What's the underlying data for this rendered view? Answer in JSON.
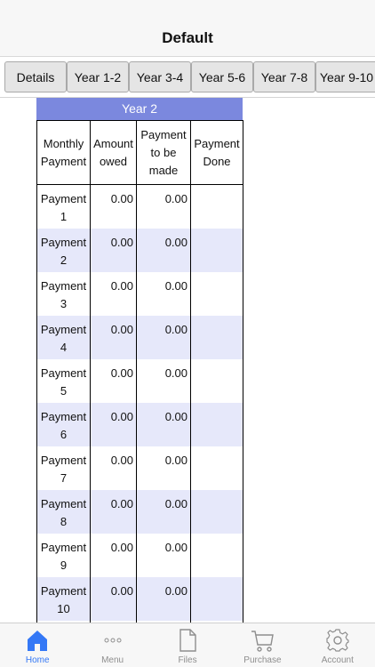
{
  "header": {
    "title": "Default"
  },
  "tabs": [
    {
      "label": "Details"
    },
    {
      "label": "Year 1-2"
    },
    {
      "label": "Year 3-4"
    },
    {
      "label": "Year 5-6"
    },
    {
      "label": "Year 7-8"
    },
    {
      "label": "Year 9-10"
    }
  ],
  "table": {
    "title": "Year 2",
    "columns": [
      "Monthly Payment",
      "Amount owed",
      "Payment to be made",
      "Payment Done"
    ],
    "rows": [
      {
        "label": "Payment 1",
        "owed": "0.00",
        "to_make": "0.00",
        "done": ""
      },
      {
        "label": "Payment 2",
        "owed": "0.00",
        "to_make": "0.00",
        "done": ""
      },
      {
        "label": "Payment 3",
        "owed": "0.00",
        "to_make": "0.00",
        "done": ""
      },
      {
        "label": "Payment 4",
        "owed": "0.00",
        "to_make": "0.00",
        "done": ""
      },
      {
        "label": "Payment 5",
        "owed": "0.00",
        "to_make": "0.00",
        "done": ""
      },
      {
        "label": "Payment 6",
        "owed": "0.00",
        "to_make": "0.00",
        "done": ""
      },
      {
        "label": "Payment 7",
        "owed": "0.00",
        "to_make": "0.00",
        "done": ""
      },
      {
        "label": "Payment 8",
        "owed": "0.00",
        "to_make": "0.00",
        "done": ""
      },
      {
        "label": "Payment 9",
        "owed": "0.00",
        "to_make": "0.00",
        "done": ""
      },
      {
        "label": "Payment 10",
        "owed": "0.00",
        "to_make": "0.00",
        "done": ""
      }
    ]
  },
  "bottom_tabs": [
    {
      "label": "Home",
      "icon": "home-icon",
      "active": true
    },
    {
      "label": "Menu",
      "icon": "more-icon",
      "active": false
    },
    {
      "label": "Files",
      "icon": "file-icon",
      "active": false
    },
    {
      "label": "Purchase",
      "icon": "cart-icon",
      "active": false
    },
    {
      "label": "Account",
      "icon": "gear-icon",
      "active": false
    }
  ],
  "colors": {
    "accent": "#3478f6",
    "year_header": "#7b88de",
    "row_alt": "#e6e8fa"
  }
}
